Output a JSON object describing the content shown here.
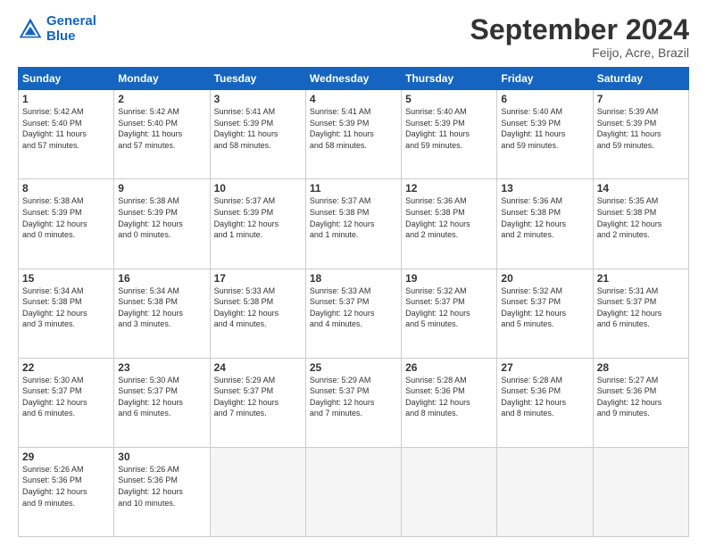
{
  "header": {
    "logo_line1": "General",
    "logo_line2": "Blue",
    "month_title": "September 2024",
    "location": "Feijo, Acre, Brazil"
  },
  "weekdays": [
    "Sunday",
    "Monday",
    "Tuesday",
    "Wednesday",
    "Thursday",
    "Friday",
    "Saturday"
  ],
  "weeks": [
    [
      {
        "day": "1",
        "info": "Sunrise: 5:42 AM\nSunset: 5:40 PM\nDaylight: 11 hours\nand 57 minutes."
      },
      {
        "day": "2",
        "info": "Sunrise: 5:42 AM\nSunset: 5:40 PM\nDaylight: 11 hours\nand 57 minutes."
      },
      {
        "day": "3",
        "info": "Sunrise: 5:41 AM\nSunset: 5:39 PM\nDaylight: 11 hours\nand 58 minutes."
      },
      {
        "day": "4",
        "info": "Sunrise: 5:41 AM\nSunset: 5:39 PM\nDaylight: 11 hours\nand 58 minutes."
      },
      {
        "day": "5",
        "info": "Sunrise: 5:40 AM\nSunset: 5:39 PM\nDaylight: 11 hours\nand 59 minutes."
      },
      {
        "day": "6",
        "info": "Sunrise: 5:40 AM\nSunset: 5:39 PM\nDaylight: 11 hours\nand 59 minutes."
      },
      {
        "day": "7",
        "info": "Sunrise: 5:39 AM\nSunset: 5:39 PM\nDaylight: 11 hours\nand 59 minutes."
      }
    ],
    [
      {
        "day": "8",
        "info": "Sunrise: 5:38 AM\nSunset: 5:39 PM\nDaylight: 12 hours\nand 0 minutes."
      },
      {
        "day": "9",
        "info": "Sunrise: 5:38 AM\nSunset: 5:39 PM\nDaylight: 12 hours\nand 0 minutes."
      },
      {
        "day": "10",
        "info": "Sunrise: 5:37 AM\nSunset: 5:39 PM\nDaylight: 12 hours\nand 1 minute."
      },
      {
        "day": "11",
        "info": "Sunrise: 5:37 AM\nSunset: 5:38 PM\nDaylight: 12 hours\nand 1 minute."
      },
      {
        "day": "12",
        "info": "Sunrise: 5:36 AM\nSunset: 5:38 PM\nDaylight: 12 hours\nand 2 minutes."
      },
      {
        "day": "13",
        "info": "Sunrise: 5:36 AM\nSunset: 5:38 PM\nDaylight: 12 hours\nand 2 minutes."
      },
      {
        "day": "14",
        "info": "Sunrise: 5:35 AM\nSunset: 5:38 PM\nDaylight: 12 hours\nand 2 minutes."
      }
    ],
    [
      {
        "day": "15",
        "info": "Sunrise: 5:34 AM\nSunset: 5:38 PM\nDaylight: 12 hours\nand 3 minutes."
      },
      {
        "day": "16",
        "info": "Sunrise: 5:34 AM\nSunset: 5:38 PM\nDaylight: 12 hours\nand 3 minutes."
      },
      {
        "day": "17",
        "info": "Sunrise: 5:33 AM\nSunset: 5:38 PM\nDaylight: 12 hours\nand 4 minutes."
      },
      {
        "day": "18",
        "info": "Sunrise: 5:33 AM\nSunset: 5:37 PM\nDaylight: 12 hours\nand 4 minutes."
      },
      {
        "day": "19",
        "info": "Sunrise: 5:32 AM\nSunset: 5:37 PM\nDaylight: 12 hours\nand 5 minutes."
      },
      {
        "day": "20",
        "info": "Sunrise: 5:32 AM\nSunset: 5:37 PM\nDaylight: 12 hours\nand 5 minutes."
      },
      {
        "day": "21",
        "info": "Sunrise: 5:31 AM\nSunset: 5:37 PM\nDaylight: 12 hours\nand 6 minutes."
      }
    ],
    [
      {
        "day": "22",
        "info": "Sunrise: 5:30 AM\nSunset: 5:37 PM\nDaylight: 12 hours\nand 6 minutes."
      },
      {
        "day": "23",
        "info": "Sunrise: 5:30 AM\nSunset: 5:37 PM\nDaylight: 12 hours\nand 6 minutes."
      },
      {
        "day": "24",
        "info": "Sunrise: 5:29 AM\nSunset: 5:37 PM\nDaylight: 12 hours\nand 7 minutes."
      },
      {
        "day": "25",
        "info": "Sunrise: 5:29 AM\nSunset: 5:37 PM\nDaylight: 12 hours\nand 7 minutes."
      },
      {
        "day": "26",
        "info": "Sunrise: 5:28 AM\nSunset: 5:36 PM\nDaylight: 12 hours\nand 8 minutes."
      },
      {
        "day": "27",
        "info": "Sunrise: 5:28 AM\nSunset: 5:36 PM\nDaylight: 12 hours\nand 8 minutes."
      },
      {
        "day": "28",
        "info": "Sunrise: 5:27 AM\nSunset: 5:36 PM\nDaylight: 12 hours\nand 9 minutes."
      }
    ],
    [
      {
        "day": "29",
        "info": "Sunrise: 5:26 AM\nSunset: 5:36 PM\nDaylight: 12 hours\nand 9 minutes."
      },
      {
        "day": "30",
        "info": "Sunrise: 5:26 AM\nSunset: 5:36 PM\nDaylight: 12 hours\nand 10 minutes."
      },
      {
        "day": "",
        "info": ""
      },
      {
        "day": "",
        "info": ""
      },
      {
        "day": "",
        "info": ""
      },
      {
        "day": "",
        "info": ""
      },
      {
        "day": "",
        "info": ""
      }
    ]
  ]
}
